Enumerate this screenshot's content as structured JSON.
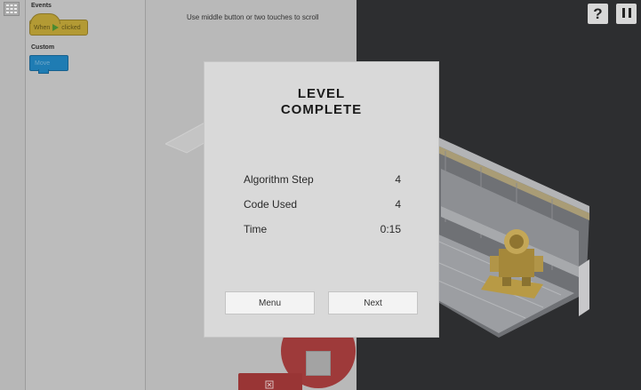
{
  "palette": {
    "categories": [
      "Events",
      "Custom"
    ],
    "event_block": {
      "when": "When",
      "clicked": "clicked"
    },
    "custom_block": {
      "label": "Move"
    }
  },
  "workspace": {
    "scroll_hint": "Use middle button or two touches to scroll"
  },
  "controls": {
    "help_icon": "question-mark",
    "pause_icon": "pause"
  },
  "modal": {
    "title_line1": "LEVEL",
    "title_line2": "COMPLETE",
    "stats": [
      {
        "label": "Algorithm Step",
        "value": "4"
      },
      {
        "label": "Code Used",
        "value": "4"
      },
      {
        "label": "Time",
        "value": "0:15"
      }
    ],
    "buttons": {
      "menu": "Menu",
      "next": "Next"
    }
  },
  "colors": {
    "event_block": "#b39a34",
    "custom_block": "#1f7cb3",
    "stop_button": "#9e3a3a",
    "modal_bg": "#d9d9d9"
  }
}
